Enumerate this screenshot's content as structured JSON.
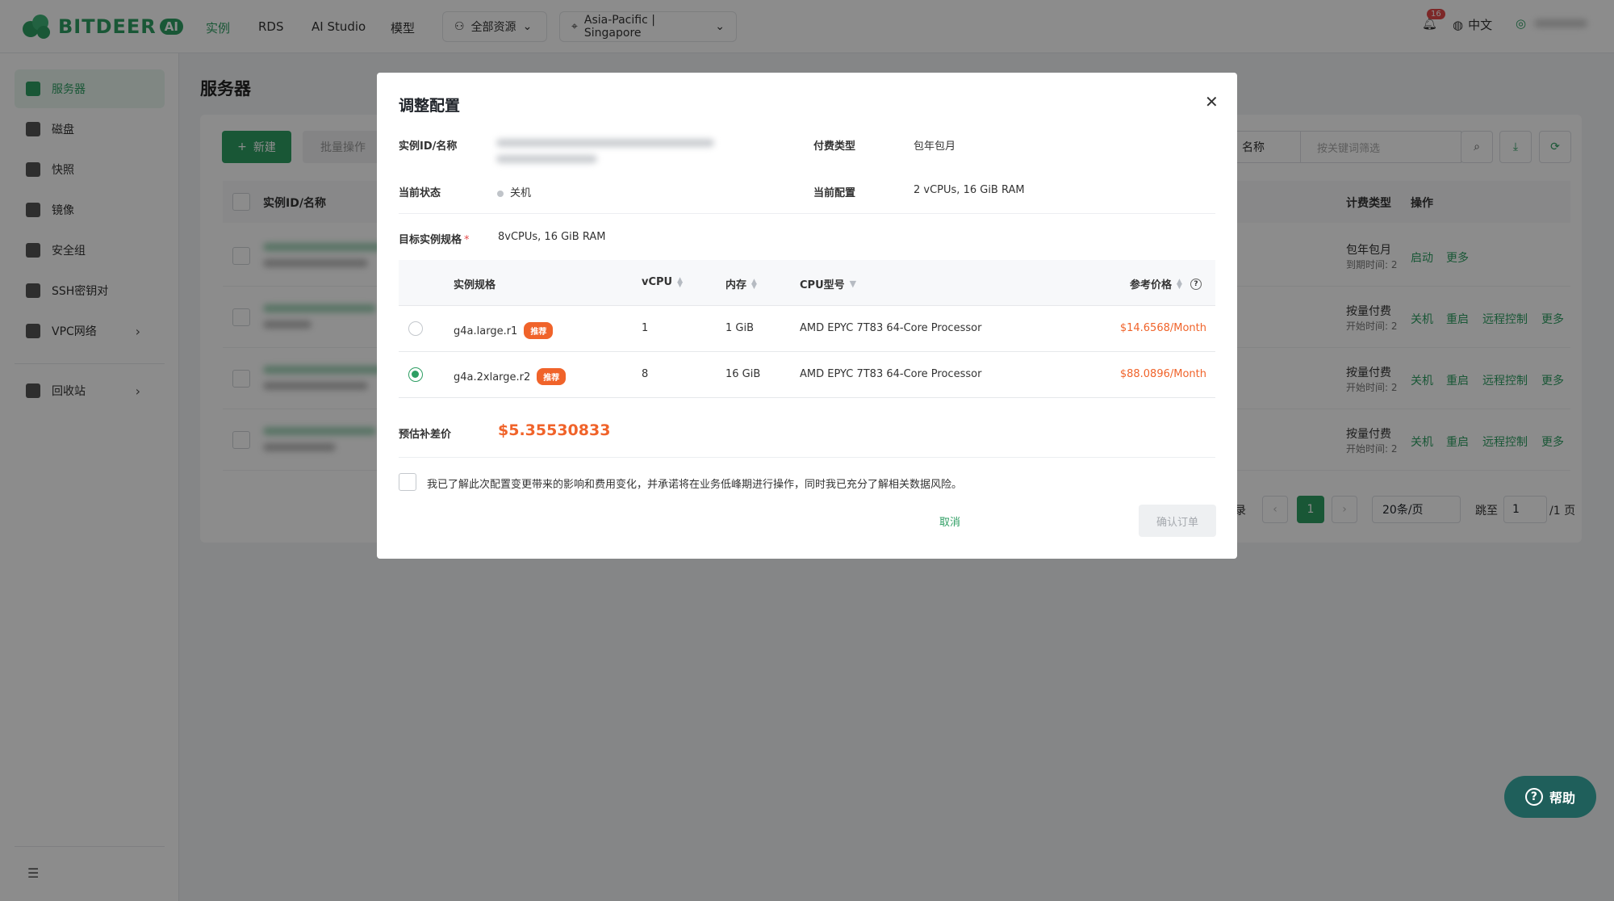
{
  "brand": {
    "name": "BITDEER",
    "suffix": "AI"
  },
  "topnav": {
    "links": [
      "实例",
      "RDS",
      "AI Studio",
      "模型"
    ],
    "resource_dropdown": "全部资源",
    "region_dropdown": "Asia-Pacific | Singapore",
    "notification_count": "16",
    "language": "中文"
  },
  "sidebar": {
    "items": [
      "服务器",
      "磁盘",
      "快照",
      "镜像",
      "安全组",
      "SSH密钥对",
      "VPC网络"
    ],
    "recycle": "回收站"
  },
  "page": {
    "title": "服务器",
    "new_button": "新建",
    "batch_button": "批量操作",
    "filter_select": "名称",
    "search_placeholder": "按关键词筛选",
    "columns": {
      "id_name": "实例ID/名称",
      "billing": "计费类型",
      "actions": "操作"
    },
    "rows": [
      {
        "billing": "包年包月",
        "time": "到期时间: 2",
        "actions": [
          "启动",
          "更多"
        ]
      },
      {
        "billing": "按量付费",
        "time": "开始时间: 2",
        "actions": [
          "关机",
          "重启",
          "远程控制",
          "更多"
        ]
      },
      {
        "billing": "按量付费",
        "time": "开始时间: 2",
        "actions": [
          "关机",
          "重启",
          "远程控制",
          "更多"
        ]
      },
      {
        "billing": "按量付费",
        "time": "开始时间: 2",
        "actions": [
          "关机",
          "重启",
          "远程控制",
          "更多"
        ]
      }
    ],
    "pagination": {
      "total_suffix": "录",
      "current": "1",
      "page_size": "20条/页",
      "jump_label": "跳至",
      "jump_value": "1",
      "total_pages": "/1 页"
    }
  },
  "modal": {
    "title": "调整配置",
    "instance_label": "实例ID/名称",
    "billing_label": "付费类型",
    "billing_value": "包年包月",
    "status_label": "当前状态",
    "status_value": "关机",
    "config_label": "当前配置",
    "config_value": "2 vCPUs, 16 GiB RAM",
    "target_label": "目标实例规格",
    "target_value": "8vCPUs, 16 GiB RAM",
    "table": {
      "headers": {
        "spec": "实例规格",
        "vcpu": "vCPU",
        "memory": "内存",
        "cpu_model": "CPU型号",
        "price": "参考价格"
      },
      "rows": [
        {
          "spec": "g4a.large.r1",
          "tag": "推荐",
          "vcpu": "1",
          "memory": "1 GiB",
          "cpu_model": "AMD EPYC 7T83 64-Core Processor",
          "price": "$14.6568/Month",
          "selected": false
        },
        {
          "spec": "g4a.2xlarge.r2",
          "tag": "推荐",
          "vcpu": "8",
          "memory": "16 GiB",
          "cpu_model": "AMD EPYC 7T83 64-Core Processor",
          "price": "$88.0896/Month",
          "selected": true
        }
      ]
    },
    "diff_label": "预估补差价",
    "diff_value": "$5.35530833",
    "agreement": "我已了解此次配置变更带来的影响和费用变化，并承诺将在业务低峰期进行操作，同时我已充分了解相关数据风险。",
    "cancel": "取消",
    "confirm": "确认订单"
  },
  "help": {
    "label": "帮助"
  }
}
